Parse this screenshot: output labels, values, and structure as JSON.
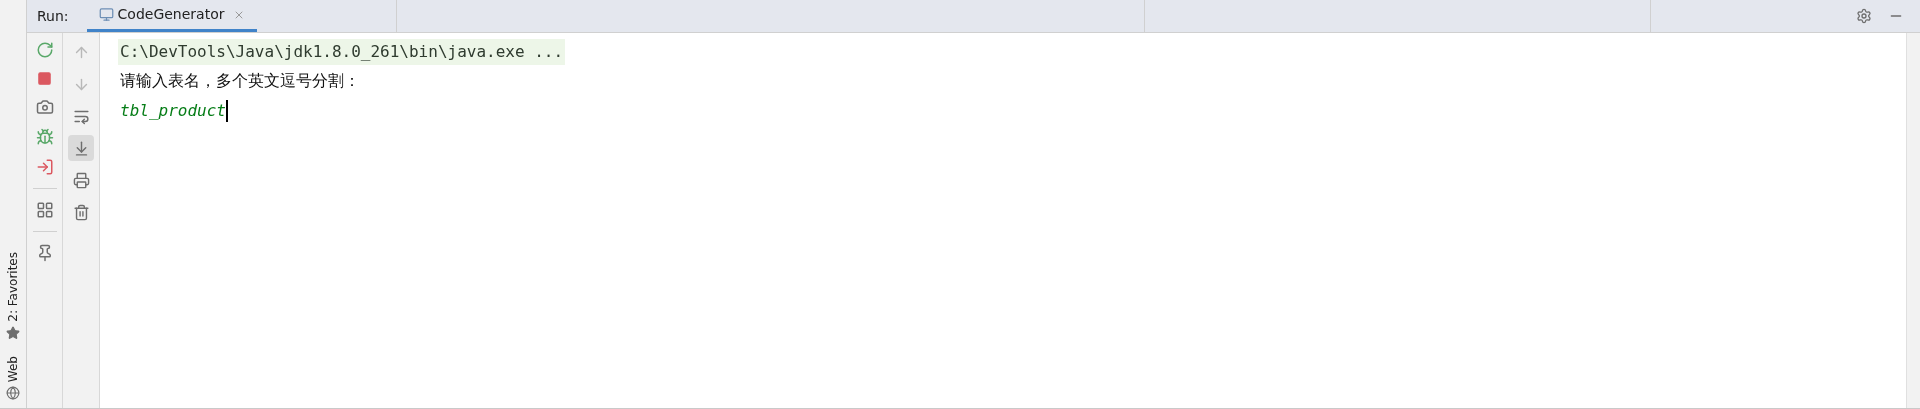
{
  "run_panel": {
    "title": "Run:",
    "tabs": [
      {
        "label": "CodeGenerator",
        "selected": true
      }
    ]
  },
  "left_stripe": [
    {
      "label": "2: Favorites",
      "kind": "star"
    },
    {
      "label": "Web",
      "kind": "globe"
    }
  ],
  "toolbar_secondary": [
    {
      "kind": "up",
      "disabled": true,
      "selected": false
    },
    {
      "kind": "down",
      "disabled": true,
      "selected": false
    },
    {
      "kind": "wrap",
      "disabled": false,
      "selected": false
    },
    {
      "kind": "scroll",
      "disabled": false,
      "selected": true
    },
    {
      "kind": "print",
      "disabled": false,
      "selected": false
    },
    {
      "kind": "trash",
      "disabled": false,
      "selected": false
    }
  ],
  "console": [
    {
      "kind": "command",
      "text": "C:\\DevTools\\Java\\jdk1.8.0_261\\bin\\java.exe ..."
    },
    {
      "kind": "output",
      "text": "请输入表名，多个英文逗号分割："
    },
    {
      "kind": "input",
      "text": "tbl_product"
    }
  ]
}
